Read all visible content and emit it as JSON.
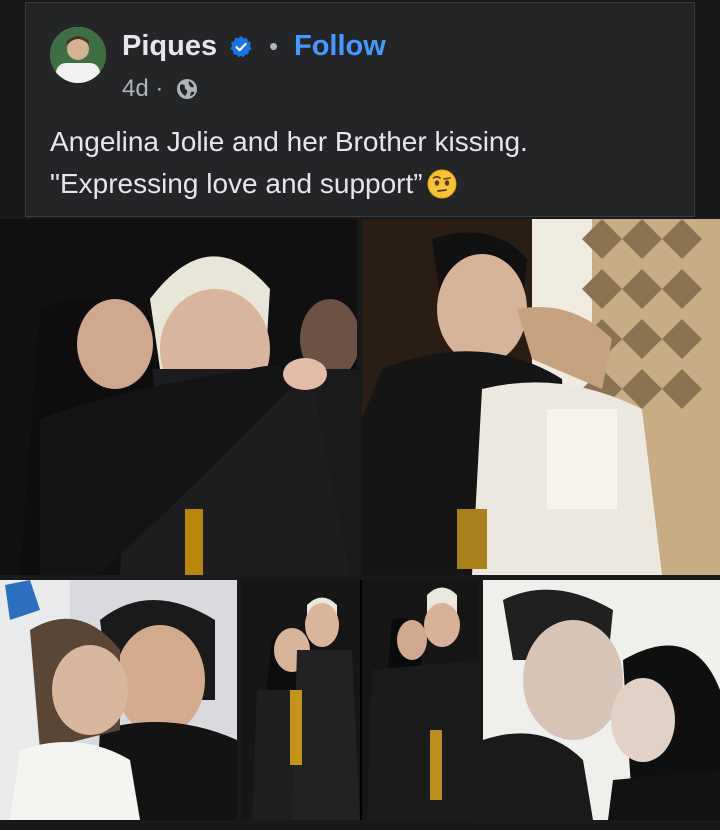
{
  "post": {
    "author": "Piques",
    "follow_label": "Follow",
    "separator": "•",
    "time": "4d ·",
    "text_line1": "Angelina Jolie and her Brother kissing.",
    "text_line2": "\"Expressing love and support”"
  },
  "icons": {
    "verified": "verified-badge-icon",
    "audience": "globe-icon",
    "emoji": "face-with-raised-eyebrow-emoji"
  },
  "colors": {
    "background": "#18191a",
    "card": "#242526",
    "text": "#e4e6eb",
    "secondary_text": "#b0b3b8",
    "link": "#4599ff",
    "verified": "#1b74e4"
  },
  "photos": {
    "count": 5
  }
}
